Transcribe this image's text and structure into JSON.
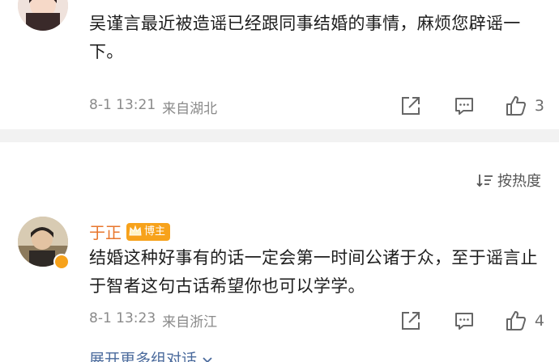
{
  "comment1": {
    "username": "",
    "text": "吴谨言最近被造谣已经跟同事结婚的事情，麻烦您辟谣一下。",
    "time": "8-1 13:21",
    "location": "来自湖北",
    "likes": "3"
  },
  "sort": {
    "label": "按热度"
  },
  "comment2": {
    "username": "于正",
    "badge": "博主",
    "text": "结婚这种好事有的话一定会第一时间公诸于众，至于谣言止于智者这句古话希望你也可以学学。",
    "time": "8-1 13:23",
    "location": "来自浙江",
    "likes": "4",
    "expand": "展开更多组对话"
  },
  "colors": {
    "accent": "#f7a21b",
    "username": "#e8762c",
    "link": "#4a6a9c"
  },
  "icons": [
    "share-icon",
    "comment-icon",
    "like-icon",
    "sort-icon",
    "chevron-down-icon"
  ]
}
